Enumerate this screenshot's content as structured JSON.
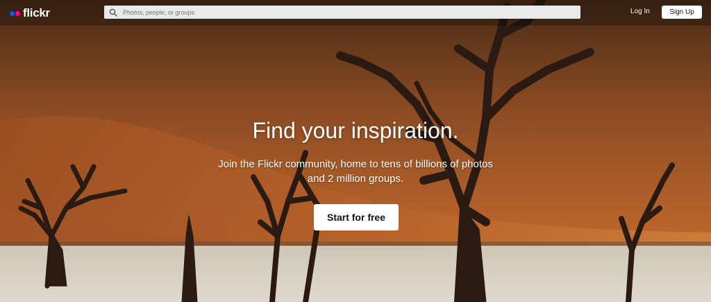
{
  "brand": {
    "name": "flickr",
    "dot_colors": [
      "#0063dc",
      "#ff0084"
    ]
  },
  "header": {
    "search": {
      "placeholder": "Photos, people, or groups",
      "icon": "search-icon"
    },
    "login_label": "Log In",
    "signup_label": "Sign Up"
  },
  "hero": {
    "headline": "Find your inspiration.",
    "subtext": "Join the Flickr community, home to tens of billions of photos and 2 million groups.",
    "cta_label": "Start for free",
    "background": "desert dunes with dead trees"
  },
  "colors": {
    "dune_orange": "#b8642b",
    "sand_floor": "#d8d0c4",
    "tree_dark": "#2a1a12"
  }
}
